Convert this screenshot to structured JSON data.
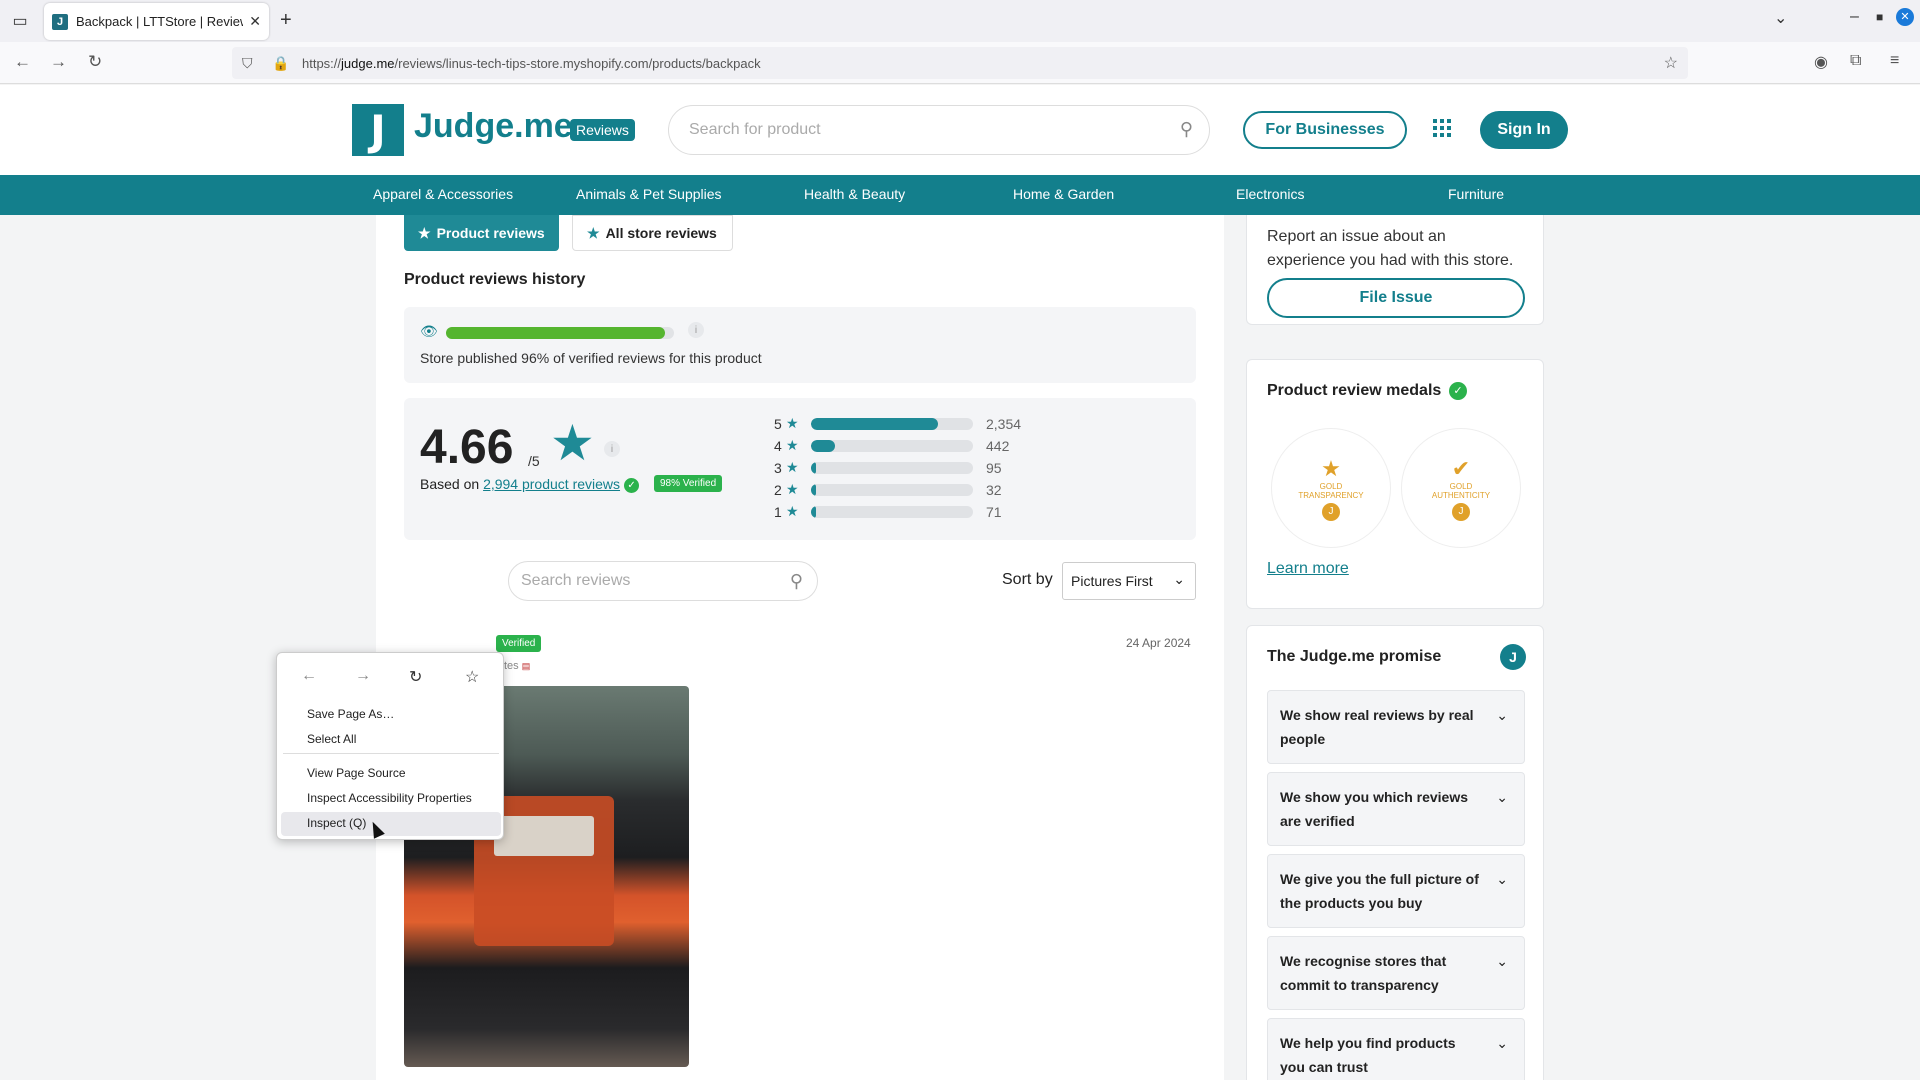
{
  "browser": {
    "tab_title": "Backpack | LTTStore | Review",
    "url_prefix": "https://",
    "url_host": "judge.me",
    "url_path": "/reviews/linus-tech-tips-store.myshopify.com/products/backpack"
  },
  "header": {
    "logo_letter": "J",
    "logo_text": "Judge.me",
    "logo_badge": "Reviews",
    "search_placeholder": "Search for product",
    "for_businesses": "For Businesses",
    "sign_in": "Sign In"
  },
  "categories": [
    "Apparel & Accessories",
    "Animals & Pet Supplies",
    "Health & Beauty",
    "Home & Garden",
    "Electronics",
    "Furniture"
  ],
  "main": {
    "tab_product": "Product reviews",
    "tab_store": "All store reviews",
    "history_title": "Product reviews history",
    "published_fraction": 0.96,
    "published_text": "Store published 96% of verified reviews for this product",
    "score": "4.66",
    "out_of": "/5",
    "based_on_prefix": "Based on",
    "based_on_link": "2,994 product reviews",
    "verified_pct": "98% Verified",
    "histogram": [
      {
        "stars": "5",
        "count": "2,354",
        "value": 2354
      },
      {
        "stars": "4",
        "count": "442",
        "value": 442
      },
      {
        "stars": "3",
        "count": "95",
        "value": 95
      },
      {
        "stars": "2",
        "count": "32",
        "value": 32
      },
      {
        "stars": "1",
        "count": "71",
        "value": 71
      }
    ],
    "review_search_placeholder": "Search reviews",
    "sort_label": "Sort by",
    "sort_value": "Pictures First",
    "review_verified": "Verified",
    "review_location": "tes",
    "review_date": "24 Apr 2024"
  },
  "context_menu": {
    "save_page": "Save Page As…",
    "select_all": "Select All",
    "view_source": "View Page Source",
    "inspect_accessibility": "Inspect Accessibility Properties",
    "inspect": "Inspect (Q)"
  },
  "sidebar": {
    "report_text": "Report an issue about an experience you had with this store.",
    "file_issue": "File Issue",
    "medals_title": "Product review medals",
    "medal1_line1": "GOLD",
    "medal1_line2": "TRANSPARENCY",
    "medal2_line1": "GOLD",
    "medal2_line2": "AUTHENTICITY",
    "learn_more": "Learn more",
    "promise_title": "The Judge.me promise",
    "promises": [
      "We show real reviews by real people",
      "We show you which reviews are verified",
      "We give you the full picture of the products you buy",
      "We recognise stores that commit to transparency",
      "We help you find products you can trust"
    ]
  },
  "colors": {
    "brand": "#137f8c",
    "verified": "#2bb24c",
    "medal": "#e0a12a"
  }
}
